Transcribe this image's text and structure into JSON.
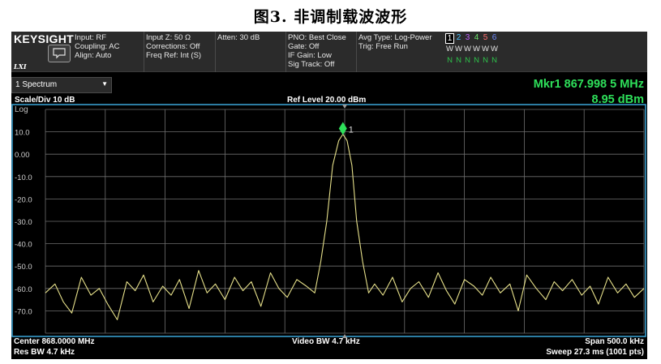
{
  "figure_caption": "图3. 非调制载波波形",
  "instrument": {
    "brand": "KEYSIGHT",
    "badge": "LXI",
    "settings": {
      "col1": [
        "Input: RF",
        "Coupling: AC",
        "Align: Auto"
      ],
      "col2": [
        "Input Z: 50 Ω",
        "Corrections: Off",
        "Freq Ref: Int (S)"
      ],
      "col3": [
        "Atten: 30 dB"
      ],
      "col4": [
        "PNO: Best Close",
        "Gate: Off",
        "IF Gain: Low",
        "Sig Track: Off"
      ],
      "col5": [
        "Avg Type: Log-Power",
        "Trig: Free Run"
      ]
    },
    "traces": {
      "numbers": [
        "1",
        "2",
        "3",
        "4",
        "5",
        "6"
      ],
      "types": [
        "W",
        "W",
        "W",
        "W",
        "W",
        "W"
      ],
      "detectors": [
        "N",
        "N",
        "N",
        "N",
        "N",
        "N"
      ]
    }
  },
  "display": {
    "window_select": "1 Spectrum",
    "scale_div": "Scale/Div 10 dB",
    "scale_type": "Log",
    "ref_level": "Ref Level 20.00 dBm",
    "marker_freq": "Mkr1  867.998 5 MHz",
    "marker_amp": "8.95 dBm",
    "center": "Center 868.0000 MHz",
    "res_bw": "Res BW 4.7 kHz",
    "video_bw": "Video BW 4.7 kHz",
    "span": "Span 500.0 kHz",
    "sweep": "Sweep 27.3 ms (1001 pts)"
  },
  "colors": {
    "trace": "#e6e08a",
    "marker": "#2ee05a",
    "grid": "#6e6e6e",
    "frame": "#3aa6d8"
  },
  "chart_data": {
    "type": "line",
    "title": "",
    "xlabel": "",
    "ylabel": "",
    "x_unit": "MHz",
    "y_unit": "dBm",
    "xlim": [
      867.75,
      868.25
    ],
    "ylim": [
      -80,
      20
    ],
    "y_ticks": [
      "10.0",
      "0.00",
      "-10.0",
      "-20.0",
      "-30.0",
      "-40.0",
      "-50.0",
      "-60.0",
      "-70.0"
    ],
    "y_tick_values": [
      10,
      0,
      -10,
      -20,
      -30,
      -40,
      -50,
      -60,
      -70
    ],
    "grid": true,
    "marker": {
      "label": "1",
      "x": 867.9985,
      "y": 8.95
    },
    "series": [
      {
        "name": "",
        "x": [
          867.75,
          867.758,
          867.765,
          867.772,
          867.78,
          867.788,
          867.795,
          867.802,
          867.81,
          867.818,
          867.825,
          867.832,
          867.84,
          867.848,
          867.855,
          867.862,
          867.87,
          867.878,
          867.885,
          867.892,
          867.9,
          867.908,
          867.915,
          867.922,
          867.93,
          867.938,
          867.945,
          867.952,
          867.96,
          867.968,
          867.975,
          867.98,
          867.985,
          867.99,
          867.995,
          867.9985,
          868.002,
          868.006,
          868.01,
          868.015,
          868.02,
          868.025,
          868.032,
          868.04,
          868.048,
          868.055,
          868.062,
          868.07,
          868.078,
          868.085,
          868.092,
          868.1,
          868.108,
          868.115,
          868.122,
          868.13,
          868.138,
          868.145,
          868.152,
          868.16,
          868.168,
          868.175,
          868.182,
          868.19,
          868.198,
          868.205,
          868.212,
          868.22,
          868.228,
          868.235,
          868.242,
          868.25
        ],
        "y": [
          -62,
          -58,
          -66,
          -71,
          -55,
          -63,
          -60,
          -67,
          -74,
          -57,
          -61,
          -54,
          -66,
          -59,
          -63,
          -56,
          -69,
          -52,
          -62,
          -58,
          -65,
          -55,
          -61,
          -57,
          -68,
          -53,
          -60,
          -64,
          -56,
          -59,
          -62,
          -48,
          -30,
          -5,
          6,
          8.95,
          6,
          -5,
          -30,
          -48,
          -62,
          -58,
          -63,
          -55,
          -66,
          -60,
          -57,
          -64,
          -53,
          -61,
          -67,
          -56,
          -59,
          -63,
          -55,
          -62,
          -58,
          -70,
          -54,
          -60,
          -65,
          -57,
          -61,
          -56,
          -63,
          -59,
          -67,
          -55,
          -62,
          -58,
          -64,
          -60
        ]
      }
    ]
  }
}
